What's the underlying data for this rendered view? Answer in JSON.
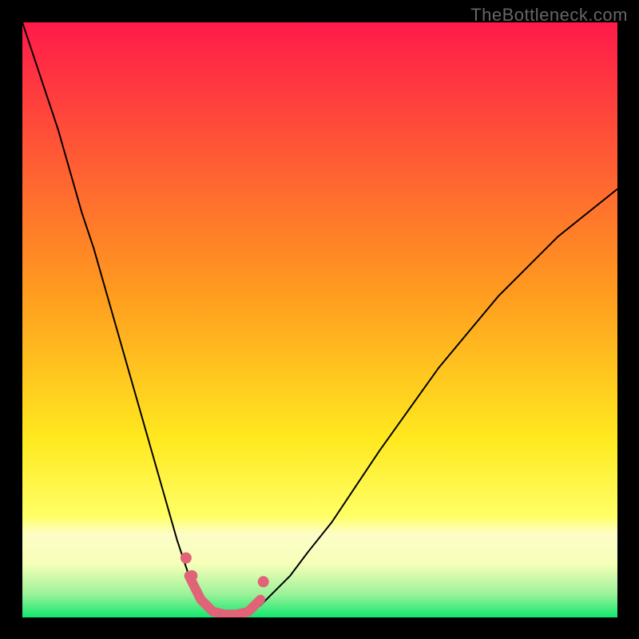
{
  "watermark": "TheBottleneck.com",
  "chart_data": {
    "type": "line",
    "title": "",
    "xlabel": "",
    "ylabel": "",
    "xlim": [
      0,
      100
    ],
    "ylim": [
      0,
      100
    ],
    "background_gradient_stops": [
      {
        "pos": 0.0,
        "color": "#ff1a4a"
      },
      {
        "pos": 0.45,
        "color": "#ff9a1f"
      },
      {
        "pos": 0.7,
        "color": "#ffe91f"
      },
      {
        "pos": 0.83,
        "color": "#ffff66"
      },
      {
        "pos": 0.86,
        "color": "#fdfdc7"
      },
      {
        "pos": 0.91,
        "color": "#f6ffb8"
      },
      {
        "pos": 0.96,
        "color": "#9ef29a"
      },
      {
        "pos": 1.0,
        "color": "#13e76f"
      }
    ],
    "series": [
      {
        "name": "left-curve",
        "stroke": "#000000",
        "width": 2,
        "x": [
          0,
          2,
          4,
          6,
          8,
          10,
          12,
          14,
          16,
          18,
          20,
          22,
          24,
          26,
          27,
          28,
          29,
          30,
          31,
          32
        ],
        "y": [
          100,
          94,
          88,
          82,
          75,
          68,
          62,
          55,
          48,
          41,
          34,
          27,
          20,
          13,
          10,
          7,
          5,
          3,
          1.5,
          1
        ]
      },
      {
        "name": "right-curve",
        "stroke": "#000000",
        "width": 2,
        "x": [
          38,
          40,
          42,
          45,
          48,
          52,
          56,
          60,
          65,
          70,
          75,
          80,
          85,
          90,
          95,
          100
        ],
        "y": [
          1,
          2,
          4,
          7,
          11,
          16,
          22,
          28,
          35,
          42,
          48,
          54,
          59,
          64,
          68,
          72
        ]
      },
      {
        "name": "trough-highlight",
        "stroke": "#e06377",
        "width": 12,
        "linecap": "round",
        "x": [
          28,
          30,
          32,
          34,
          36,
          38,
          40
        ],
        "y": [
          7,
          3,
          1,
          0.5,
          0.5,
          1,
          3
        ]
      }
    ],
    "dots": [
      {
        "x": 27.5,
        "y": 10,
        "r": 7,
        "color": "#e06377"
      },
      {
        "x": 28.5,
        "y": 7,
        "r": 7,
        "color": "#e06377"
      },
      {
        "x": 40.5,
        "y": 6,
        "r": 7,
        "color": "#e06377"
      }
    ]
  }
}
